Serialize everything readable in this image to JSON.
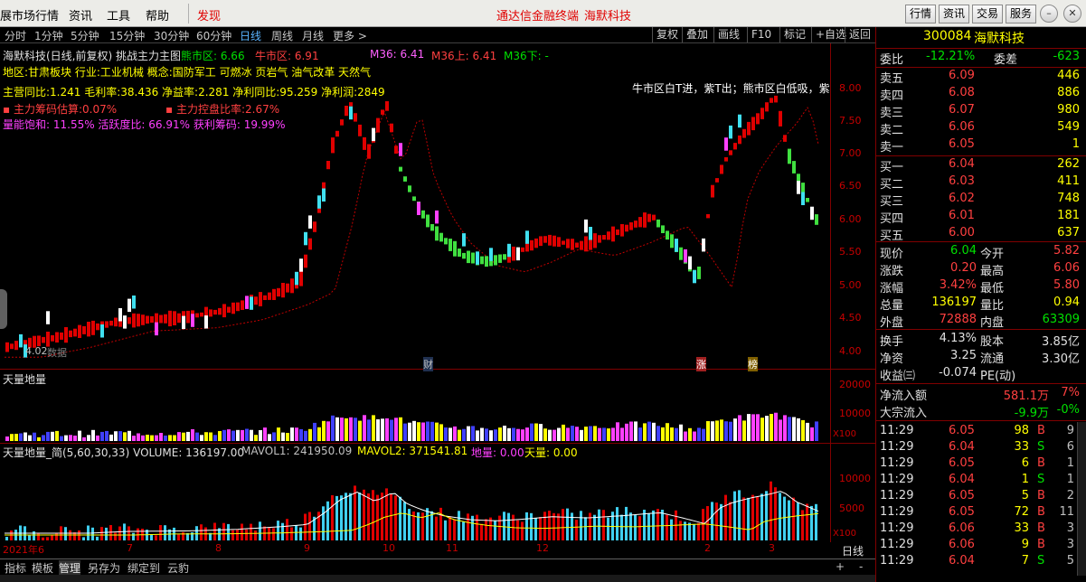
{
  "menu": {
    "items": [
      "展市场行情",
      "资讯",
      "工具",
      "帮助"
    ],
    "discover": "发现",
    "center_title": "通达信金融终端",
    "center_stock": "海默科技",
    "right_buttons": [
      "行情",
      "资讯",
      "交易",
      "服务"
    ]
  },
  "periods": {
    "items": [
      "分时",
      "1分钟",
      "5分钟",
      "15分钟",
      "30分钟",
      "60分钟",
      "日线",
      "周线",
      "月线",
      "更多 >"
    ],
    "active": "日线",
    "tools": [
      "复权",
      "叠加",
      "画线",
      "F10",
      "标记",
      "+自选",
      "返回"
    ]
  },
  "chart": {
    "title_line": "海默科技(日线,前复权) 挑战主力主图",
    "xiong": "熊市区: 6.66",
    "niu": "牛市区: 6.91",
    "m36": "M36: 6.41",
    "m36up": "M36上: 6.41",
    "m36down": "M36下: -",
    "info1": "地区:甘肃板块    行业:工业机械    概念:国防军工 可燃冰 页岩气 油气改革 天然气",
    "info2": "主营同比:1.241  毛利率:38.436    净益率:2.281  净利同比:95.259   净利润:2849",
    "chip1": "主力筹码估算:0.07%",
    "chip2": "主力控盘比率:2.67%",
    "chip3": "量能饱和: 11.55%  活跃度比: 66.91%  获利筹码: 19.99%",
    "hint": "牛市区白T进，紫T出；熊市区白低吸，紫",
    "low_label": "4.02",
    "low_label2": "数据",
    "events": [
      "财",
      "涨",
      "榜"
    ],
    "y_ticks": [
      "8.00",
      "7.50",
      "7.00",
      "6.50",
      "6.00",
      "5.50",
      "5.00",
      "4.50",
      "4.00"
    ],
    "vol_title": "天量地量",
    "vol_ticks": [
      "20000",
      "10000"
    ],
    "x100": "X100",
    "vol2_title": "天量地量_简(5,60,30,33) VOLUME: 136197.00",
    "mavol1": "MAVOL1: 241950.09",
    "mavol2": "MAVOL2: 371541.81",
    "diliang": "地量: 0.00",
    "tianliang": "天量: 0.00",
    "vol2_ticks": [
      "10000",
      "5000"
    ],
    "x_labels": [
      "2021年6",
      "7",
      "8",
      "9",
      "10",
      "11",
      "12",
      "2",
      "3"
    ],
    "period_badge": "日线"
  },
  "bottom": {
    "tabs": [
      "指标",
      "模板",
      "管理",
      "另存为",
      "绑定到",
      "云豹"
    ],
    "active": "管理",
    "plus": "+",
    "minus": "-"
  },
  "quote": {
    "code": "300084",
    "name": "海默科技",
    "weibi_label": "委比",
    "weibi": "-12.21%",
    "weicha_label": "委差",
    "weicha": "-623",
    "asks": [
      {
        "label": "卖五",
        "price": "6.09",
        "vol": "446"
      },
      {
        "label": "卖四",
        "price": "6.08",
        "vol": "886"
      },
      {
        "label": "卖三",
        "price": "6.07",
        "vol": "980"
      },
      {
        "label": "卖二",
        "price": "6.06",
        "vol": "549"
      },
      {
        "label": "卖一",
        "price": "6.05",
        "vol": "1"
      }
    ],
    "bids": [
      {
        "label": "买一",
        "price": "6.04",
        "vol": "262"
      },
      {
        "label": "买二",
        "price": "6.03",
        "vol": "411"
      },
      {
        "label": "买三",
        "price": "6.02",
        "vol": "748"
      },
      {
        "label": "买四",
        "price": "6.01",
        "vol": "181"
      },
      {
        "label": "买五",
        "price": "6.00",
        "vol": "637"
      }
    ],
    "stats": [
      {
        "l1": "现价",
        "v1": "6.04",
        "l2": "今开",
        "v2": "5.82",
        "c1": "#00e000",
        "c2": "#ff4040"
      },
      {
        "l1": "涨跌",
        "v1": "0.20",
        "l2": "最高",
        "v2": "6.06",
        "c1": "#ff4040",
        "c2": "#ff4040"
      },
      {
        "l1": "涨幅",
        "v1": "3.42%",
        "l2": "最低",
        "v2": "5.80",
        "c1": "#ff4040",
        "c2": "#ff4040"
      },
      {
        "l1": "总量",
        "v1": "136197",
        "l2": "量比",
        "v2": "0.94",
        "c1": "#ffff00",
        "c2": "#ffff00"
      },
      {
        "l1": "外盘",
        "v1": "72888",
        "l2": "内盘",
        "v2": "63309",
        "c1": "#ff4040",
        "c2": "#00e000"
      }
    ],
    "stats2": [
      {
        "l1": "换手",
        "v1": "4.13%",
        "l2": "股本",
        "v2": "3.85亿"
      },
      {
        "l1": "净资",
        "v1": "3.25",
        "l2": "流通",
        "v2": "3.30亿"
      },
      {
        "l1": "收益㈢",
        "v1": "-0.074",
        "l2": "PE(动)",
        "v2": ""
      }
    ],
    "flow": [
      {
        "label": "净流入额",
        "val": "581.1万",
        "pct": "7%",
        "c": "#ff4040"
      },
      {
        "label": "大宗流入",
        "val": "-9.9万",
        "pct": "-0%",
        "c": "#00e000"
      }
    ],
    "ticks": [
      {
        "t": "11:29",
        "p": "6.05",
        "v": "98",
        "bs": "B",
        "n": "9"
      },
      {
        "t": "11:29",
        "p": "6.04",
        "v": "33",
        "bs": "S",
        "n": "6"
      },
      {
        "t": "11:29",
        "p": "6.05",
        "v": "6",
        "bs": "B",
        "n": "1"
      },
      {
        "t": "11:29",
        "p": "6.04",
        "v": "1",
        "bs": "S",
        "n": "1"
      },
      {
        "t": "11:29",
        "p": "6.05",
        "v": "5",
        "bs": "B",
        "n": "2"
      },
      {
        "t": "11:29",
        "p": "6.05",
        "v": "72",
        "bs": "B",
        "n": "11"
      },
      {
        "t": "11:29",
        "p": "6.06",
        "v": "33",
        "bs": "B",
        "n": "3"
      },
      {
        "t": "11:29",
        "p": "6.06",
        "v": "9",
        "bs": "B",
        "n": "3"
      },
      {
        "t": "11:29",
        "p": "6.04",
        "v": "7",
        "bs": "S",
        "n": "5"
      }
    ]
  }
}
